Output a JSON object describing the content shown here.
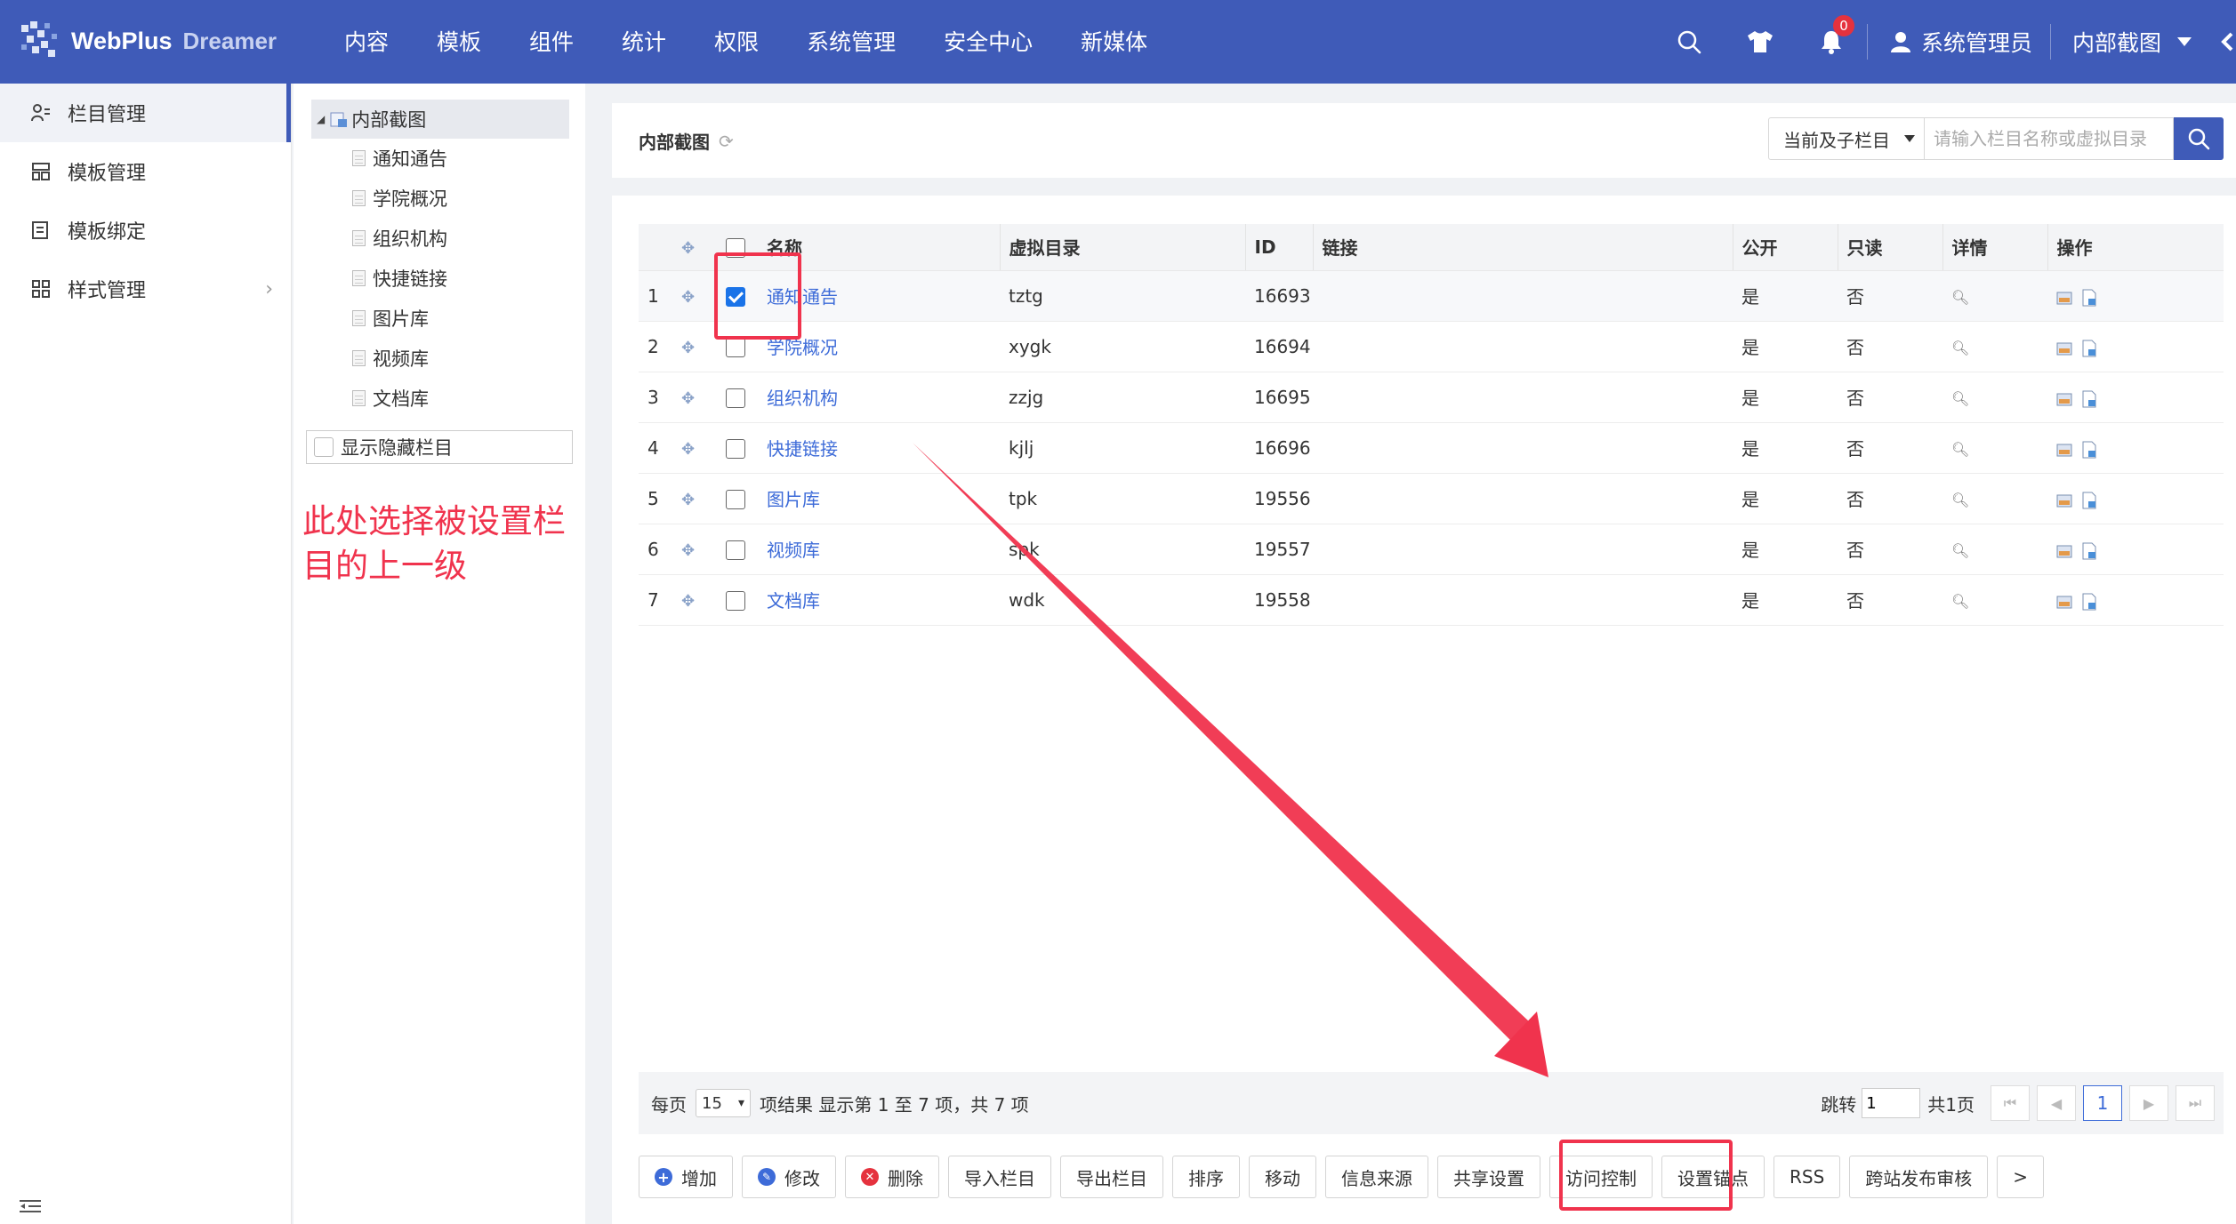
{
  "brand": {
    "name": "WebPlus",
    "sub": "Dreamer"
  },
  "nav": [
    "内容",
    "模板",
    "组件",
    "统计",
    "权限",
    "系统管理",
    "安全中心",
    "新媒体"
  ],
  "topbar": {
    "notification_count": "0",
    "user": "系统管理员",
    "dept": "内部截图"
  },
  "sidebar": {
    "items": [
      {
        "label": "栏目管理",
        "icon": "column-icon",
        "active": true
      },
      {
        "label": "模板管理",
        "icon": "template-icon",
        "active": false
      },
      {
        "label": "模板绑定",
        "icon": "bind-icon",
        "active": false
      },
      {
        "label": "样式管理",
        "icon": "style-icon",
        "active": false
      }
    ]
  },
  "tree": {
    "root": "内部截图",
    "children": [
      "通知通告",
      "学院概况",
      "组织机构",
      "快捷链接",
      "图片库",
      "视频库",
      "文档库"
    ],
    "show_hidden": "显示隐藏栏目"
  },
  "annotation": "此处选择被设置栏目的上一级",
  "main": {
    "title": "内部截图",
    "search_scope": "当前及子栏目",
    "search_placeholder": "请输入栏目名称或虚拟目录"
  },
  "table": {
    "headers": {
      "name": "名称",
      "vdir": "虚拟目录",
      "id": "ID",
      "link": "链接",
      "public": "公开",
      "readonly": "只读",
      "detail": "详情",
      "ops": "操作"
    },
    "rows": [
      {
        "no": "1",
        "name": "通知通告",
        "vdir": "tztg",
        "id": "16693",
        "link": "",
        "public": "是",
        "readonly": "否",
        "checked": true
      },
      {
        "no": "2",
        "name": "学院概况",
        "vdir": "xygk",
        "id": "16694",
        "link": "",
        "public": "是",
        "readonly": "否",
        "checked": false
      },
      {
        "no": "3",
        "name": "组织机构",
        "vdir": "zzjg",
        "id": "16695",
        "link": "",
        "public": "是",
        "readonly": "否",
        "checked": false
      },
      {
        "no": "4",
        "name": "快捷链接",
        "vdir": "kjlj",
        "id": "16696",
        "link": "",
        "public": "是",
        "readonly": "否",
        "checked": false
      },
      {
        "no": "5",
        "name": "图片库",
        "vdir": "tpk",
        "id": "19556",
        "link": "",
        "public": "是",
        "readonly": "否",
        "checked": false
      },
      {
        "no": "6",
        "name": "视频库",
        "vdir": "spk",
        "id": "19557",
        "link": "",
        "public": "是",
        "readonly": "否",
        "checked": false
      },
      {
        "no": "7",
        "name": "文档库",
        "vdir": "wdk",
        "id": "19558",
        "link": "",
        "public": "是",
        "readonly": "否",
        "checked": false
      }
    ]
  },
  "pager": {
    "per_page_label": "每页",
    "page_size": "15",
    "summary": "项结果 显示第 1 至 7 项，共 7 项",
    "jump_label": "跳转",
    "jump_value": "1",
    "total_pages": "共1页",
    "current_page": "1"
  },
  "actions": [
    "增加",
    "修改",
    "删除",
    "导入栏目",
    "导出栏目",
    "排序",
    "移动",
    "信息来源",
    "共享设置",
    "访问控制",
    "设置锚点",
    "RSS",
    "跨站发布审核",
    ">"
  ],
  "colors": {
    "primary": "#3f5bb8",
    "link": "#3d6bd8",
    "annotation": "#f0334d",
    "add": "#3d6bd8",
    "edit": "#3d6bd8",
    "delete": "#e5323e"
  }
}
